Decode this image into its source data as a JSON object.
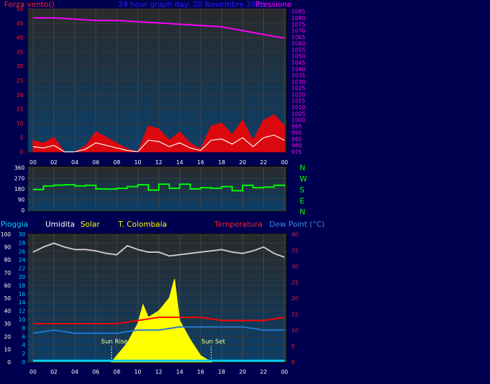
{
  "header": {
    "wind_label": "Forza vento()",
    "title": "24 hour graph day:  20 Novembre 2015",
    "pressure_label": "Pressione"
  },
  "direction_labels": [
    "N",
    "W",
    "S",
    "E",
    "N"
  ],
  "lower_header": {
    "rain": "Pioggia",
    "humidity": "Umidita",
    "solar": "Solar",
    "station": "T. Colombaia",
    "temperature": "Temperatura",
    "dewpoint": "Dew Point (°C)"
  },
  "annotations": {
    "sunrise": "Sun Rise",
    "sunset": "Sun Set"
  },
  "colors": {
    "background": "#000050",
    "plot_bg_top": "#2a2a2a",
    "plot_bg_bottom": "#0a3f6a",
    "wind": "#ff0000",
    "wind_avg": "#ffffff",
    "wind_green": "#008000",
    "pressure": "#ff00ff",
    "direction": "#00ff00",
    "humidity": "#c8c8c8",
    "solar": "#ffff00",
    "temperature": "#ff0000",
    "dewpoint": "#1e78d2",
    "rain": "#00d0ff"
  },
  "chart_data": [
    {
      "type": "line",
      "name": "wind-pressure",
      "x_ticks": [
        "00",
        "02",
        "04",
        "06",
        "08",
        "10",
        "12",
        "14",
        "16",
        "18",
        "20",
        "22",
        "00"
      ],
      "left_axis": {
        "label": "Forza vento()",
        "ylim": [
          0,
          50
        ],
        "ticks": [
          0,
          5,
          10,
          15,
          20,
          25,
          30,
          35,
          40,
          45,
          50
        ]
      },
      "right_axis": {
        "label": "Pressione",
        "ylim": [
          975,
          1087
        ],
        "ticks": [
          975,
          980,
          985,
          990,
          995,
          1000,
          1005,
          1010,
          1015,
          1020,
          1025,
          1030,
          1035,
          1040,
          1045,
          1050,
          1055,
          1060,
          1065,
          1070,
          1075,
          1080,
          1085
        ]
      },
      "series": [
        {
          "name": "Forza vento()",
          "x": [
            0,
            1,
            2,
            3,
            4,
            5,
            6,
            7,
            8,
            9,
            10,
            11,
            12,
            13,
            14,
            15,
            16,
            17,
            18,
            19,
            20,
            21,
            22,
            23,
            24
          ],
          "values": [
            4,
            3,
            5,
            0,
            0,
            2,
            7,
            5,
            3,
            1,
            0,
            9,
            8,
            4,
            7,
            3,
            1,
            9,
            10,
            6,
            11,
            4,
            11,
            13,
            9
          ]
        },
        {
          "name": "Pressione",
          "x": [
            0,
            2,
            4,
            6,
            8,
            10,
            12,
            14,
            16,
            18,
            20,
            22,
            24
          ],
          "values": [
            1080,
            1080,
            1079,
            1078,
            1078,
            1077,
            1076,
            1075,
            1074,
            1073,
            1070,
            1067,
            1064
          ]
        }
      ]
    },
    {
      "type": "line",
      "name": "wind-direction",
      "ylim": [
        0,
        360
      ],
      "y_ticks": [
        0,
        90,
        180,
        270,
        360
      ],
      "series": [
        {
          "x": [
            0,
            1,
            2,
            3,
            4,
            5,
            6,
            7,
            8,
            9,
            10,
            11,
            12,
            13,
            14,
            15,
            16,
            17,
            18,
            19,
            20,
            21,
            22,
            23,
            24
          ],
          "values": [
            175,
            205,
            212,
            215,
            205,
            210,
            180,
            178,
            185,
            200,
            215,
            170,
            220,
            185,
            220,
            180,
            190,
            185,
            200,
            165,
            210,
            190,
            195,
            210,
            200
          ]
        }
      ]
    },
    {
      "type": "line",
      "name": "humidity-solar-temperature",
      "x_ticks": [
        "00",
        "02",
        "04",
        "06",
        "08",
        "10",
        "12",
        "14",
        "16",
        "18",
        "20",
        "22",
        "00"
      ],
      "rain_axis": {
        "label": "Pioggia",
        "ylim": [
          0,
          100
        ],
        "ticks": [
          0,
          10,
          20,
          30,
          40,
          50,
          60,
          70,
          80,
          90,
          100
        ]
      },
      "humidity_axis": {
        "label": "Umidita",
        "ylim": [
          0,
          30
        ],
        "ticks": [
          0,
          2,
          4,
          6,
          8,
          10,
          12,
          14,
          16,
          18,
          20,
          22,
          24,
          26,
          28,
          30
        ]
      },
      "temperature_axis": {
        "label": "Temperatura",
        "ylim": [
          0,
          40
        ],
        "ticks": [
          0,
          5,
          10,
          15,
          20,
          25,
          30,
          35,
          40
        ]
      },
      "series": [
        {
          "name": "Umidita",
          "x": [
            0,
            1,
            2,
            3,
            4,
            5,
            6,
            7,
            8,
            9,
            10,
            11,
            12,
            13,
            14,
            15,
            16,
            17,
            18,
            19,
            20,
            21,
            22,
            23,
            24
          ],
          "values": [
            86,
            90,
            93,
            90,
            88,
            88,
            87,
            85,
            84,
            91,
            88,
            86,
            86,
            83,
            84,
            85,
            86,
            87,
            88,
            86,
            85,
            87,
            90,
            85,
            82
          ]
        },
        {
          "name": "Temperatura",
          "x": [
            0,
            2,
            4,
            6,
            8,
            10,
            12,
            14,
            16,
            18,
            20,
            22,
            24
          ],
          "values": [
            12,
            12,
            12,
            12,
            12,
            13,
            14,
            14,
            14,
            13,
            13,
            13,
            14
          ]
        },
        {
          "name": "Dew Point (°C)",
          "x": [
            0,
            2,
            4,
            6,
            8,
            10,
            12,
            14,
            16,
            18,
            20,
            22,
            24
          ],
          "values": [
            9,
            10,
            9,
            9,
            9,
            10,
            10,
            11,
            11,
            11,
            11,
            10,
            10
          ]
        },
        {
          "name": "Solar",
          "x": [
            7.5,
            8,
            9,
            10,
            10.5,
            11,
            12,
            13,
            13.5,
            14,
            15,
            16,
            17
          ],
          "values": [
            0,
            2,
            6,
            12,
            18,
            14,
            16,
            20,
            26,
            13,
            7,
            2,
            0
          ]
        },
        {
          "name": "Pioggia",
          "x": [
            0,
            24
          ],
          "values": [
            1,
            1
          ]
        }
      ]
    }
  ]
}
